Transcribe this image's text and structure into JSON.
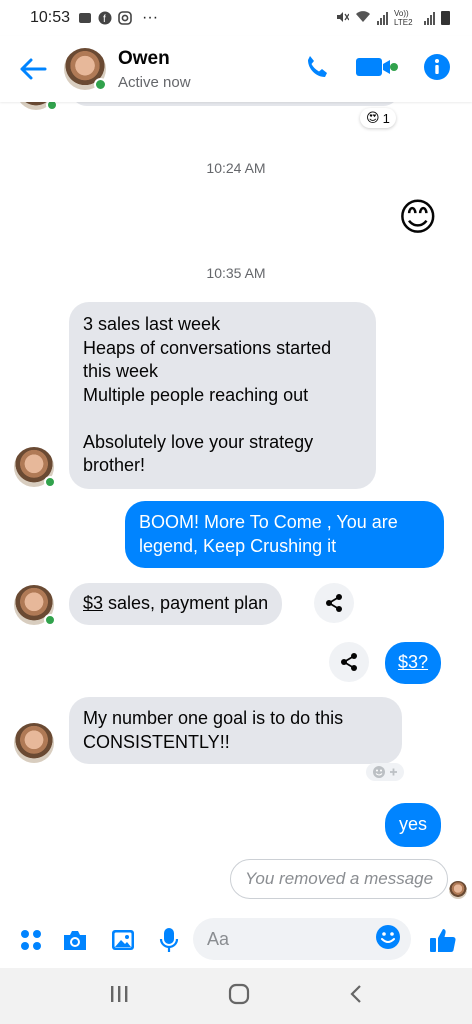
{
  "status_bar": {
    "time": "10:53",
    "network_label": "Vo)) LTE2",
    "more_dots": "···"
  },
  "header": {
    "contact_name": "Owen",
    "contact_status": "Active now"
  },
  "colors": {
    "accent": "#0084ff",
    "incoming_bubble": "#e4e6eb",
    "online": "#31a24c"
  },
  "messages": {
    "reaction_count": "1",
    "reaction_emoji": "😍",
    "ts1": "10:24 AM",
    "emoji_message": "😊",
    "ts2": "10:35 AM",
    "in1": [
      "3 sales last week",
      "Heaps of conversations started",
      "this week",
      "Multiple people reaching out",
      "",
      "Absolutely love your strategy",
      "brother!"
    ],
    "out1": [
      "BOOM! More To Come , You are",
      "legend, Keep Crushing it"
    ],
    "in2_link": "$3",
    "in2_rest": " sales, payment plan",
    "out2_link": "$3?",
    "in3": [
      "My number one goal is to do this",
      "CONSISTENTLY!!"
    ],
    "out3": "yes",
    "removed": "You removed a message"
  },
  "composer": {
    "placeholder": "Aa"
  },
  "icons": {
    "back": "arrow-left-icon",
    "call": "phone-icon",
    "video": "video-camera-icon",
    "info": "info-icon",
    "apps": "four-dots-icon",
    "camera": "camera-icon",
    "gallery": "image-icon",
    "mic": "microphone-icon",
    "emoji": "smiley-icon",
    "like": "thumbs-up-icon",
    "share": "share-icon"
  }
}
